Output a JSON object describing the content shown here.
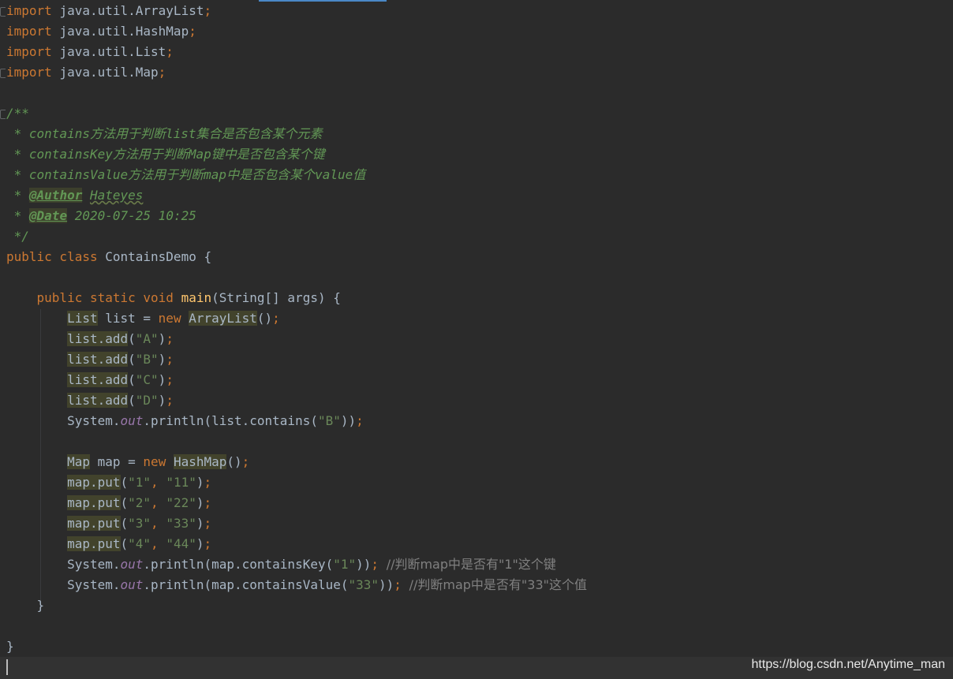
{
  "editor": {
    "language": "java",
    "imports": [
      "java.util.ArrayList",
      "java.util.HashMap",
      "java.util.List",
      "java.util.Map"
    ],
    "doc": {
      "open": "/**",
      "items": [
        {
          "code": "contains",
          "text": "方法用于判断",
          "code2": "list",
          "text2": "集合是否包含某个元素"
        },
        {
          "code": "containsKey",
          "text": "方法用于判断",
          "code2": "Map",
          "text2": "键中是否包含某个键"
        },
        {
          "code": "containsValue",
          "text": "方法用于判断",
          "code2": "map",
          "text2": "中是否包含某个",
          "code3": "value",
          "text3": "值"
        }
      ],
      "author_tag": "@Author",
      "author_value": "Hateyes",
      "date_tag": "@Date",
      "date_value": "2020-07-25 10:25",
      "close": "*/"
    },
    "class_name": "ContainsDemo",
    "method_name": "main",
    "method_params": "(String[] args) {",
    "list_var": "list",
    "list_type": "List",
    "list_impl": "ArrayList",
    "list_values": [
      "\"A\"",
      "\"B\"",
      "\"C\"",
      "\"D\""
    ],
    "contains_arg": "\"B\"",
    "map_var": "map",
    "map_type": "Map",
    "map_impl": "HashMap",
    "map_entries": [
      [
        "\"1\"",
        "\"11\""
      ],
      [
        "\"2\"",
        "\"22\""
      ],
      [
        "\"3\"",
        "\"33\""
      ],
      [
        "\"4\"",
        "\"44\""
      ]
    ],
    "containsKey_arg": "\"1\"",
    "containsKey_comment": "//判断map中是否有\"1\"这个键",
    "containsValue_arg": "\"33\"",
    "containsValue_comment": "//判断map中是否有\"33\"这个值",
    "closing_method": "}",
    "closing_class": "}"
  },
  "watermark": "https://blog.csdn.net/Anytime_man",
  "colors": {
    "background": "#2b2b2b",
    "keyword": "#cc7832",
    "string": "#6a8759",
    "javadoc": "#629755",
    "method_decl": "#ffc66d",
    "static_field": "#9876aa",
    "comment": "#808080",
    "default_text": "#a9b7c6"
  }
}
